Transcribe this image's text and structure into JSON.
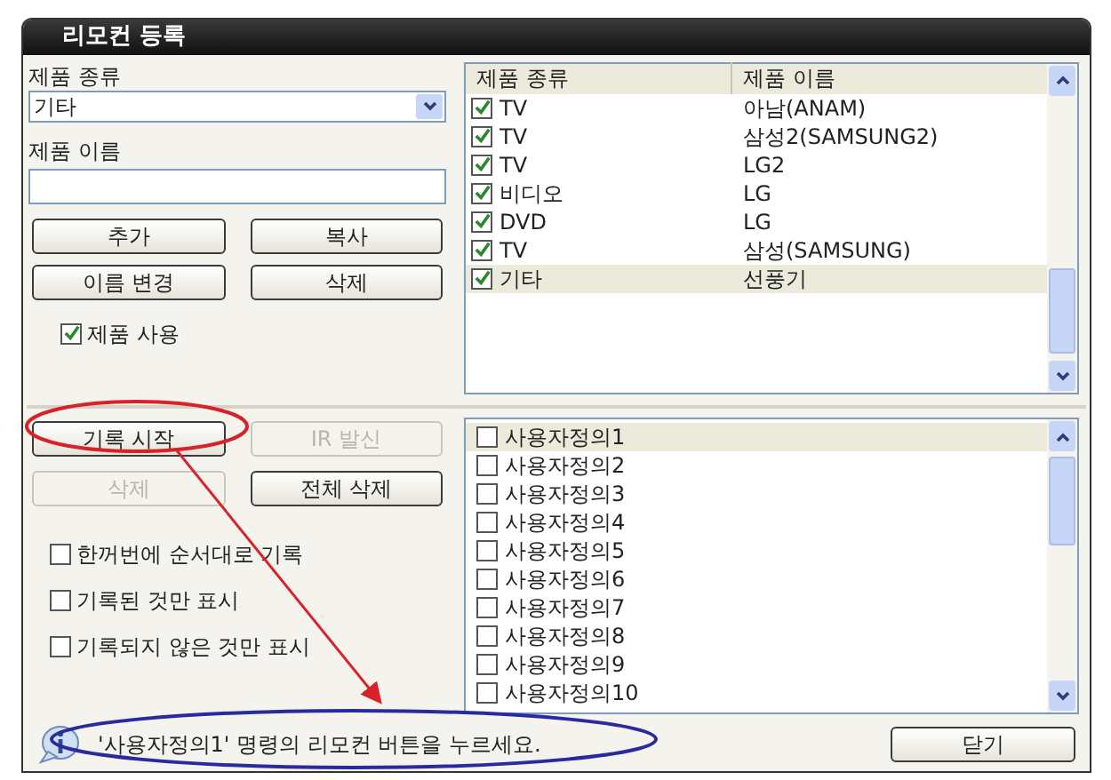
{
  "window": {
    "title": "리모컨 등록"
  },
  "product_type": {
    "label": "제품 종류",
    "value": "기타"
  },
  "product_name": {
    "label": "제품 이름"
  },
  "product_buttons": [
    {
      "label": "추가",
      "disabled": false
    },
    {
      "label": "복사",
      "disabled": false
    },
    {
      "label": "이름 변경",
      "disabled": false
    },
    {
      "label": "삭제",
      "disabled": false
    }
  ],
  "use_product": {
    "label": "제품 사용",
    "checked": true
  },
  "product_table": {
    "columns": [
      "제품 종류",
      "제품 이름"
    ],
    "rows": [
      {
        "type": "TV",
        "name": "아남(ANAM)",
        "checked": true,
        "selected": false
      },
      {
        "type": "TV",
        "name": "삼성2(SAMSUNG2)",
        "checked": true,
        "selected": false
      },
      {
        "type": "TV",
        "name": "LG2",
        "checked": true,
        "selected": false
      },
      {
        "type": "비디오",
        "name": "LG",
        "checked": true,
        "selected": false
      },
      {
        "type": "DVD",
        "name": "LG",
        "checked": true,
        "selected": false
      },
      {
        "type": "TV",
        "name": "삼성(SAMSUNG)",
        "checked": true,
        "selected": false
      },
      {
        "type": "기타",
        "name": "선풍기",
        "checked": true,
        "selected": true
      }
    ]
  },
  "record_buttons": [
    {
      "label": "기록 시작",
      "disabled": false
    },
    {
      "label": "IR 발신",
      "disabled": true
    },
    {
      "label": "삭제",
      "disabled": true
    },
    {
      "label": "전체 삭제",
      "disabled": false
    }
  ],
  "options": [
    {
      "label": "한꺼번에 순서대로 기록",
      "checked": false
    },
    {
      "label": "기록된 것만 표시",
      "checked": false
    },
    {
      "label": "기록되지 않은 것만 표시",
      "checked": false
    }
  ],
  "commands": [
    {
      "label": "사용자정의1",
      "checked": false,
      "selected": true
    },
    {
      "label": "사용자정의2",
      "checked": false,
      "selected": false
    },
    {
      "label": "사용자정의3",
      "checked": false,
      "selected": false
    },
    {
      "label": "사용자정의4",
      "checked": false,
      "selected": false
    },
    {
      "label": "사용자정의5",
      "checked": false,
      "selected": false
    },
    {
      "label": "사용자정의6",
      "checked": false,
      "selected": false
    },
    {
      "label": "사용자정의7",
      "checked": false,
      "selected": false
    },
    {
      "label": "사용자정의8",
      "checked": false,
      "selected": false
    },
    {
      "label": "사용자정의9",
      "checked": false,
      "selected": false
    },
    {
      "label": "사용자정의10",
      "checked": false,
      "selected": false
    }
  ],
  "status": {
    "message": "'사용자정의1' 명령의 리모컨 버튼을 누르세요."
  },
  "close_button": {
    "label": "닫기"
  }
}
